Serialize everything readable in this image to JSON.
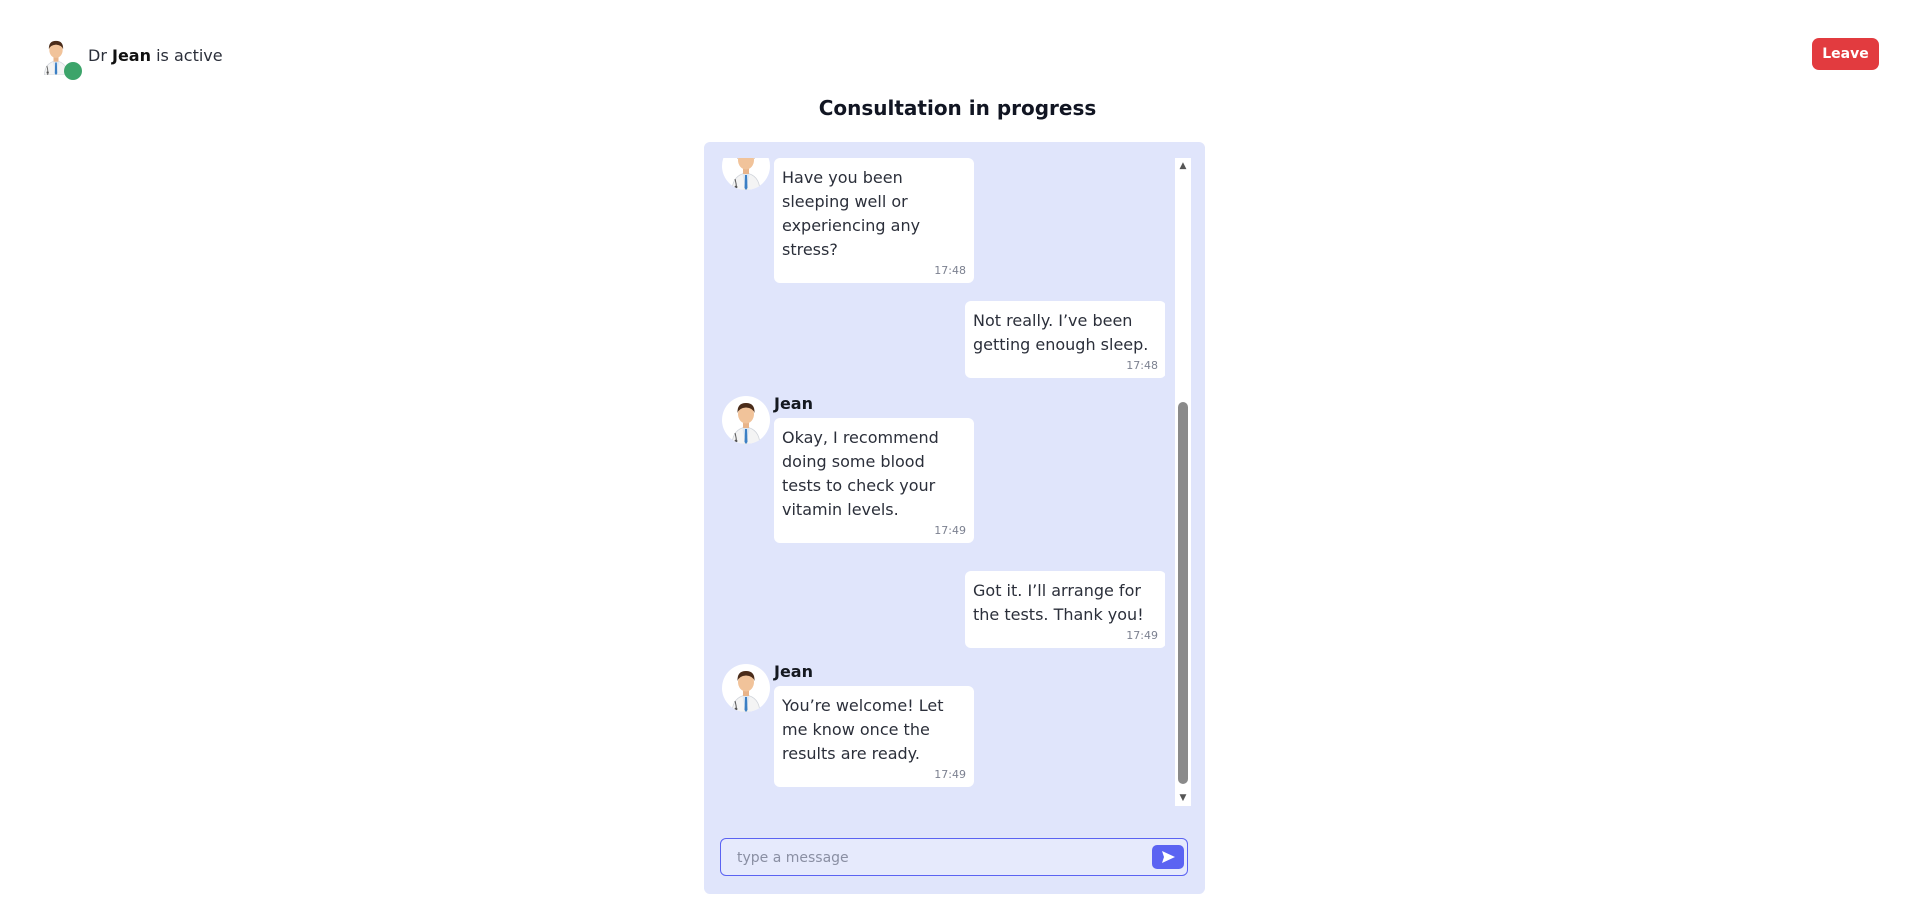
{
  "header": {
    "status_prefix": "Dr",
    "doctor_name": "Jean",
    "status_suffix": "is active",
    "leave_label": "Leave"
  },
  "page_title": "Consultation in progress",
  "messages": [
    {
      "type": "received",
      "sender": "",
      "text": "Have you been sleeping well or experiencing any stress?",
      "time": "17:48"
    },
    {
      "type": "sent",
      "text": "Not really. I’ve been getting enough sleep.",
      "time": "17:48"
    },
    {
      "type": "received",
      "sender": "Jean",
      "text": "Okay, I recommend doing some blood tests to check your vitamin levels.",
      "time": "17:49"
    },
    {
      "type": "sent",
      "text": "Got it. I’ll arrange for the tests. Thank you!",
      "time": "17:49"
    },
    {
      "type": "received",
      "sender": "Jean",
      "text": "You’re welcome! Let me know once the results are ready.",
      "time": "17:49"
    }
  ],
  "composer": {
    "placeholder": "type a message",
    "value": ""
  },
  "colors": {
    "accent": "#5b63f2",
    "leave": "#e23b3f",
    "online": "#3ca46a",
    "panel": "#e0e5fb"
  },
  "icons": {
    "doctor_avatar": "doctor-avatar-icon",
    "send": "send-icon",
    "online": "online-dot"
  }
}
